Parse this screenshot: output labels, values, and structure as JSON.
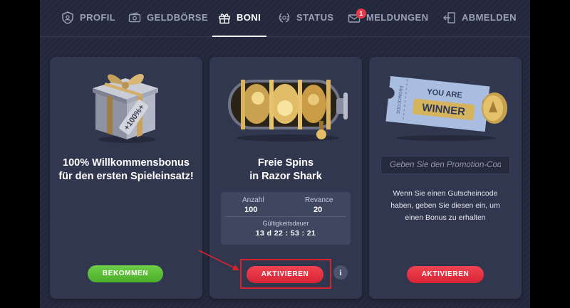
{
  "nav": {
    "items": [
      {
        "label": "PROFIL",
        "icon": "shield-user-icon"
      },
      {
        "label": "GELDBÖRSE",
        "icon": "wallet-icon"
      },
      {
        "label": "BONI",
        "icon": "gift-icon",
        "active": true
      },
      {
        "label": "STATUS",
        "icon": "laurel-icon"
      },
      {
        "label": "MELDUNGEN",
        "icon": "envelope-icon",
        "badge": "1"
      },
      {
        "label": "ABMELDEN",
        "icon": "logout-icon"
      }
    ]
  },
  "cards": {
    "welcome": {
      "title_line1": "100% Willkommensbonus",
      "title_line2": "für den ersten Spieleinsatz!",
      "image": "gift-box-image",
      "tag_text": "+100%+",
      "button": "BEKOMMEN"
    },
    "spins": {
      "title_line1": "Freie Spins",
      "title_line2": "in Razor Shark",
      "image": "slot-machine-image",
      "count_label": "Anzahl",
      "count_value": "100",
      "revance_label": "Revance",
      "revance_value": "20",
      "validity_label": "Gültigkeitsdauer",
      "validity_value": "13 d 22 : 53 : 21",
      "button": "AKTIVIEREN",
      "info": "i"
    },
    "promo": {
      "image": "winner-ticket-image",
      "ticket_line1": "YOU ARE",
      "ticket_line2": "WINNER",
      "ticket_stub": "PROMOCODE",
      "input_placeholder": "Geben Sie den Promotion-Code ein",
      "text_line1": "Wenn Sie einen Gutscheincode",
      "text_line2": "haben, geben Sie diesen ein, um",
      "text_line3": "einen Bonus zu erhalten",
      "button": "AKTIVIEREN"
    }
  },
  "colors": {
    "background": "#23283c",
    "card": "#31374e",
    "green": "#5cbf36",
    "red": "#e5323f",
    "annotation": "#d8232f"
  }
}
